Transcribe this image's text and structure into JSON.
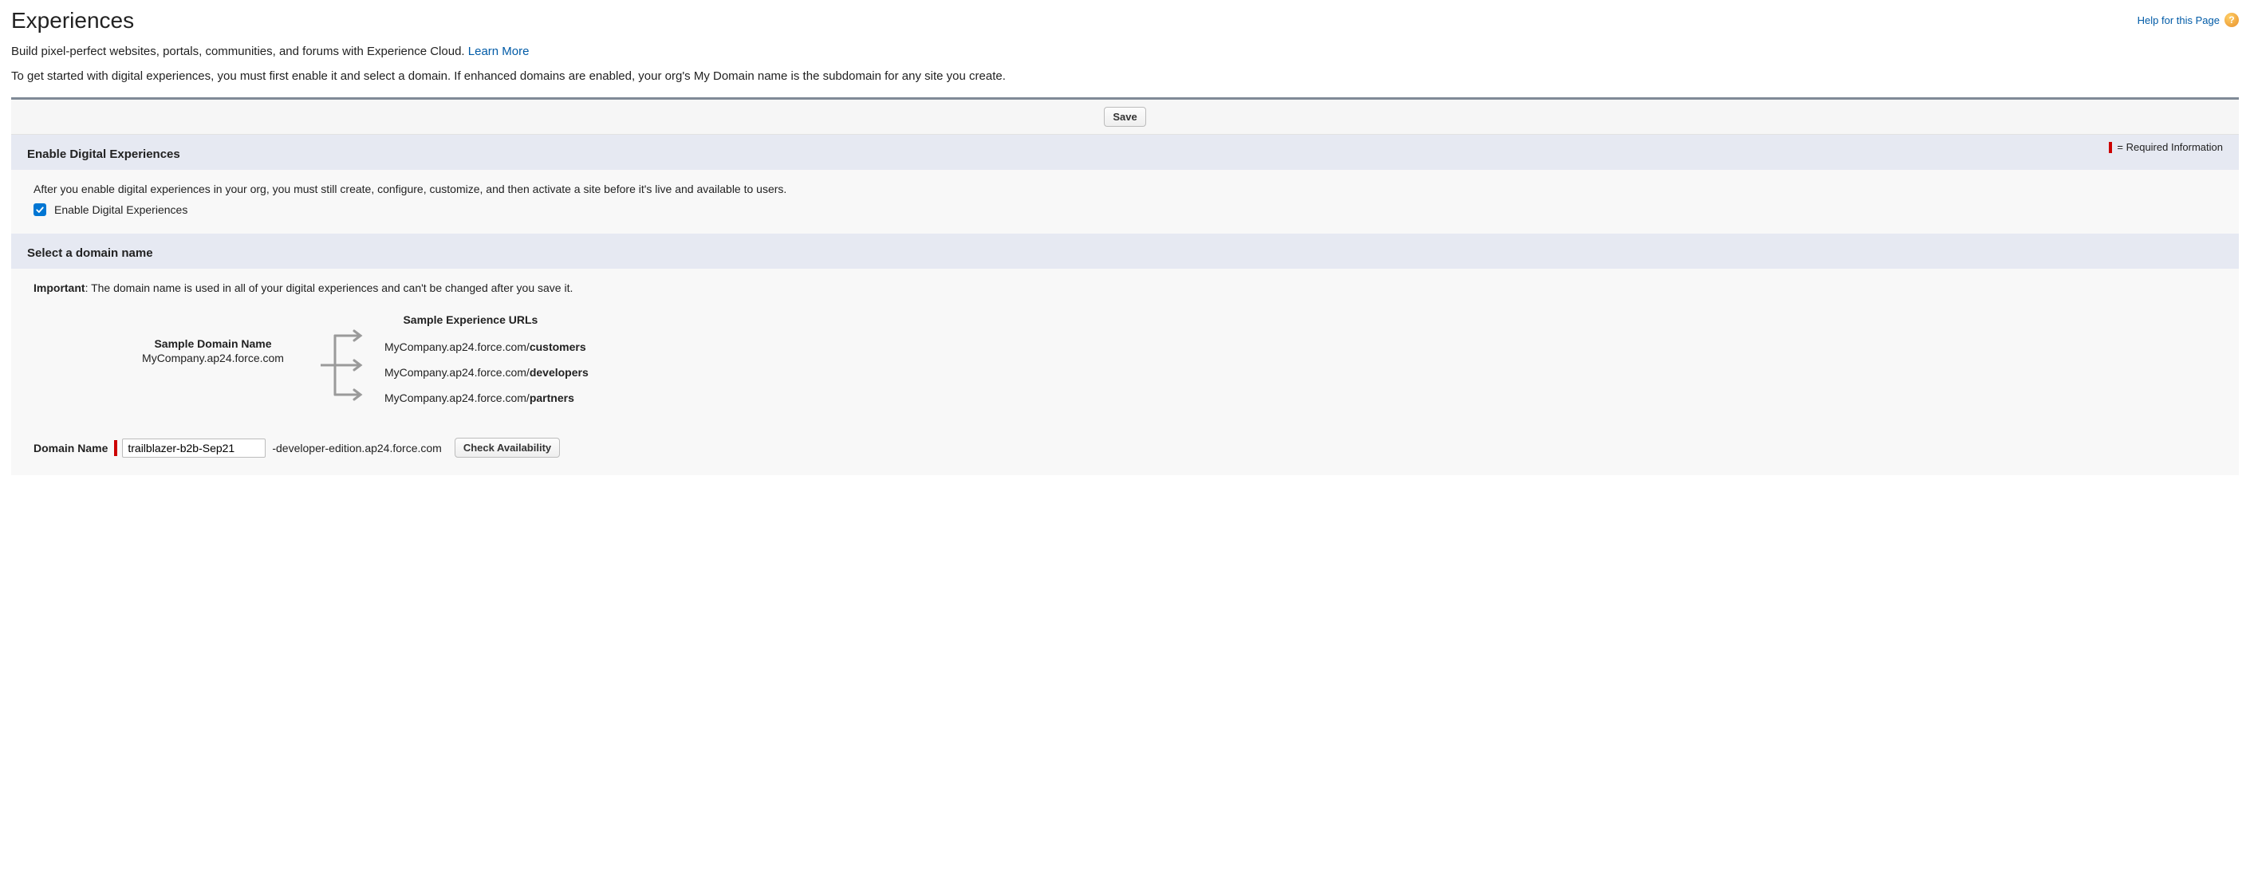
{
  "header": {
    "title": "Experiences",
    "help_link": "Help for this Page"
  },
  "intro": {
    "text": "Build pixel-perfect websites, portals, communities, and forums with Experience Cloud. ",
    "learn_more": "Learn More"
  },
  "description": "To get started with digital experiences, you must first enable it and select a domain. If enhanced domains are enabled, your org's My Domain name is the subdomain for any site you create.",
  "toolbar": {
    "save_label": "Save"
  },
  "required_info_label": "= Required Information",
  "sections": {
    "enable": {
      "title": "Enable Digital Experiences",
      "info": "After you enable digital experiences in your org, you must still create, configure, customize, and then activate a site before it's live and available to users.",
      "checkbox_label": "Enable Digital Experiences",
      "checked": true
    },
    "domain": {
      "title": "Select a domain name",
      "important_label": "Important",
      "important_text": ": The domain name is used in all of your digital experiences and can't be changed after you save it.",
      "sample_domain_title": "Sample Domain Name",
      "sample_domain_value": "MyCompany.ap24.force.com",
      "sample_urls_title": "Sample Experience URLs",
      "sample_url_prefix": "MyCompany.ap24.force.com/",
      "sample_urls": [
        {
          "suffix": "customers"
        },
        {
          "suffix": "developers"
        },
        {
          "suffix": "partners"
        }
      ],
      "domain_name_label": "Domain Name",
      "domain_input_value": "trailblazer-b2b-Sep21",
      "domain_suffix": "-developer-edition.ap24.force.com",
      "check_availability_label": "Check Availability"
    }
  }
}
